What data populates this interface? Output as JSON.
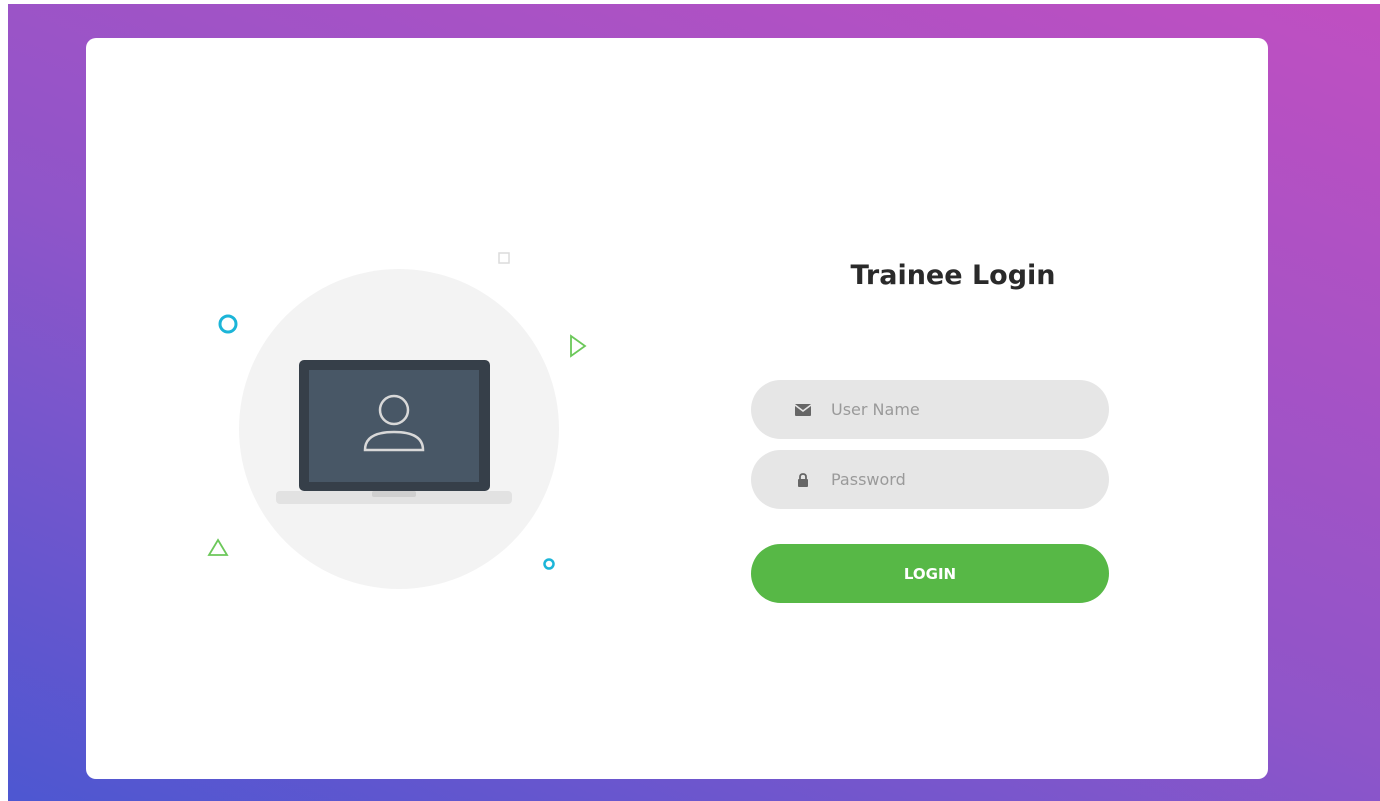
{
  "login": {
    "title": "Trainee Login",
    "username_placeholder": "User Name",
    "password_placeholder": "Password",
    "button_label": "LOGIN"
  },
  "colors": {
    "accent": "#57b846",
    "field_bg": "#e6e6e6",
    "gradient_start": "#4d57d1",
    "gradient_end": "#c04fc1"
  },
  "icons": {
    "username_icon": "envelope-icon",
    "password_icon": "lock-icon"
  }
}
